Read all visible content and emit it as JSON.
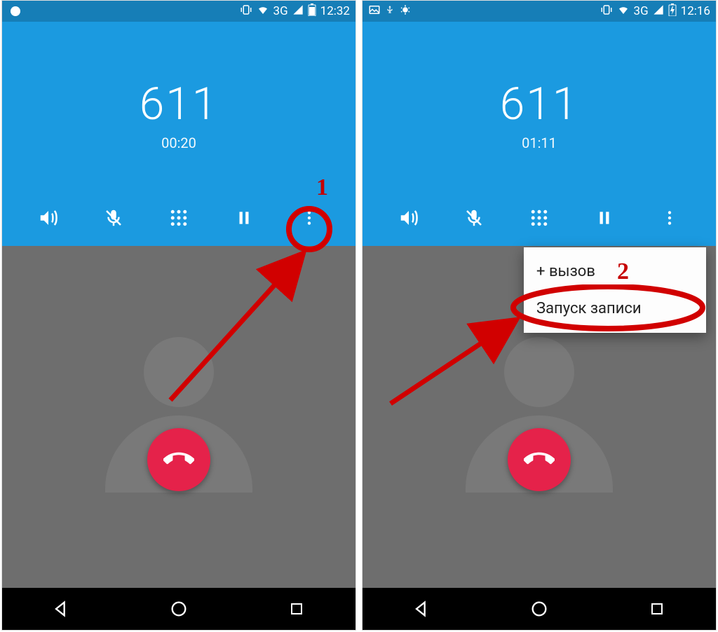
{
  "left": {
    "status": {
      "network": "3G",
      "time": "12:32"
    },
    "call": {
      "number": "611",
      "duration": "00:20"
    },
    "annotation": {
      "num": "1"
    }
  },
  "right": {
    "status": {
      "network": "3G",
      "time": "12:16"
    },
    "call": {
      "number": "611",
      "duration": "01:11"
    },
    "menu": {
      "item1": "+ вызов",
      "item2": "Запуск записи"
    },
    "annotation": {
      "num": "2"
    }
  }
}
